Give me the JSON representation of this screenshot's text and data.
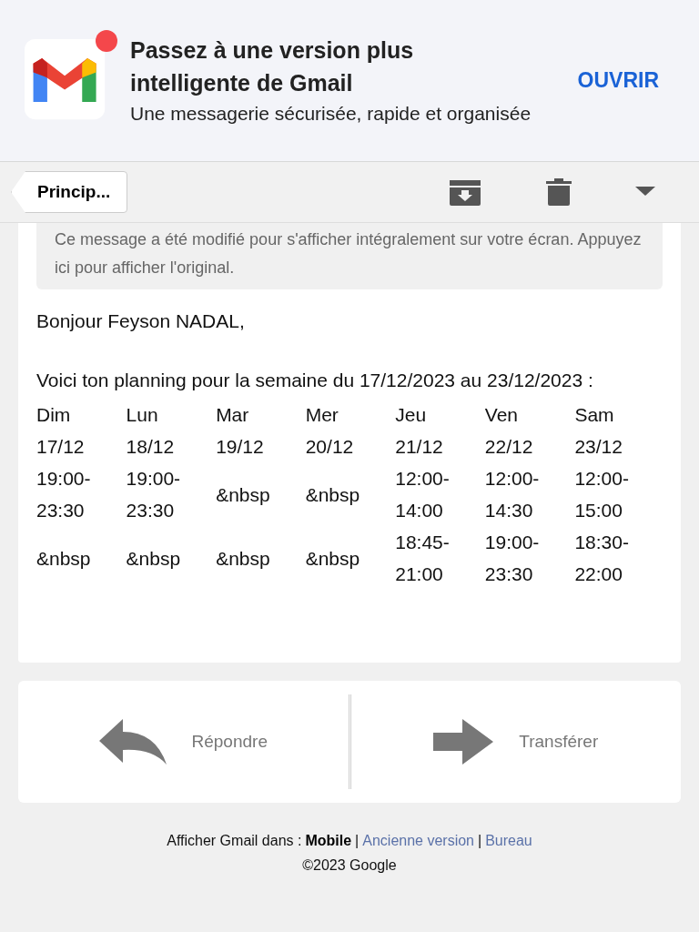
{
  "banner": {
    "title": "Passez à une version plus intelligente de Gmail",
    "subtitle": "Une messagerie sécurisée, rapide et organisée",
    "action": "OUVRIR",
    "notification": true
  },
  "toolbar": {
    "back": "Princip..."
  },
  "notice": "Ce message a été modifié pour s'afficher intégralement sur votre écran. Appuyez ici pour afficher l'original.",
  "greeting": "Bonjour Feyson NADAL,",
  "intro": "Voici ton planning pour la semaine du 17/12/2023 au 23/12/2023 :",
  "schedule": {
    "rows": [
      [
        "Dim",
        "Lun",
        "Mar",
        "Mer",
        "Jeu",
        "Ven",
        "Sam"
      ],
      [
        "17/12",
        "18/12",
        "19/12",
        "20/12",
        "21/12",
        "22/12",
        "23/12"
      ],
      [
        "19:00-23:30",
        "19:00-23:30",
        "&nbsp",
        "&nbsp",
        "12:00-14:00",
        "12:00-14:30",
        "12:00-15:00"
      ],
      [
        "&nbsp",
        "&nbsp",
        "&nbsp",
        "&nbsp",
        "18:45-21:00",
        "19:00-23:30",
        "18:30-22:00"
      ]
    ]
  },
  "actions": [
    {
      "kind": "reply",
      "label": "Répondre"
    },
    {
      "kind": "forward",
      "label": "Transférer"
    }
  ],
  "footer": {
    "label": "Afficher Gmail dans :",
    "separator": "|",
    "views": [
      {
        "label": "Mobile",
        "selected": true
      },
      {
        "label": "Ancienne version",
        "selected": false
      },
      {
        "label": "Bureau",
        "selected": false
      }
    ],
    "copyright": "©2023 Google"
  }
}
